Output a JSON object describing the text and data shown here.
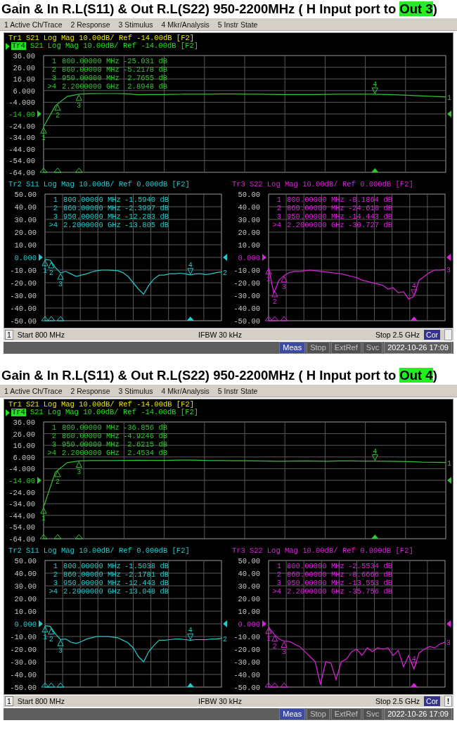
{
  "panels": [
    {
      "title": {
        "before": "Gain & In R.L(S11) & Out R.L(S22) 950-2200MHz ( H Input port to ",
        "highlight": "Out 3",
        "after": ")"
      },
      "menu": [
        "1 Active Ch/Trace",
        "2 Response",
        "3 Stimulus",
        "4 Mkr/Analysis",
        "5 Instr State"
      ],
      "top": {
        "headers": [
          {
            "trace": "Tr1",
            "param": "S21",
            "text": "Log Mag 10.00dB/ Ref -14.00dB [F2]",
            "color": "#e6e600",
            "selected": false
          },
          {
            "trace": "Tr4",
            "text": "Log Mag 10.00dB/ Ref -14.00dB [F2]",
            "color": "#22e022",
            "selected": true
          }
        ],
        "readout": [
          {
            "num": "1",
            "freq": "800.00000 MHz",
            "value": "-25.031 dB",
            "selected": false,
            "level": 0
          },
          {
            "num": "2",
            "freq": "860.00000 MHz",
            "value": "-5.2178 dB",
            "selected": false,
            "level": 0.035
          },
          {
            "num": "3",
            "freq": "950.00000 MHz",
            "value": "2.7655 dB",
            "selected": false,
            "level": 0.088
          },
          {
            "num": ">4",
            "freq": "2.2000000 GHz",
            "value": "2.8948 dB",
            "selected": true,
            "level": 0.824
          }
        ],
        "end_label": "1",
        "chart_data": {
          "type": "line",
          "grid": true,
          "categories": [
            null,
            null,
            null,
            null,
            null,
            null,
            null,
            null,
            null,
            null,
            null,
            null,
            null,
            null,
            null,
            null,
            null,
            null,
            null,
            null,
            null,
            null,
            null,
            null,
            null,
            null,
            null,
            null,
            null,
            null,
            null,
            null,
            null,
            null,
            null
          ],
          "ylim": [
            -64,
            36
          ],
          "yticks": [
            {
              "value": 36,
              "label": "36.00"
            },
            {
              "value": 26,
              "label": "26.00"
            },
            {
              "value": 16,
              "label": "16.00"
            },
            {
              "value": 6,
              "label": "6.000"
            },
            {
              "value": -4,
              "label": "-4.000"
            },
            {
              "value": -14,
              "label": "-14.00"
            },
            {
              "value": -24,
              "label": "-24.00"
            },
            {
              "value": -34,
              "label": "-34.00"
            },
            {
              "value": -44,
              "label": "-44.00"
            },
            {
              "value": -54,
              "label": "-54.00"
            },
            {
              "value": -64,
              "label": "-64.00"
            }
          ],
          "series": [
            {
              "name": "S21",
              "color": "#33c433",
              "values": [
                -25,
                -7,
                1,
                3,
                3.4,
                3.5,
                3.5,
                3.3,
                2.5,
                2.6,
                2.7,
                2.8,
                2.9,
                3,
                3,
                3.1,
                3.1,
                3,
                3,
                2.8,
                2.6,
                2.6,
                2.6,
                2.7,
                2.8,
                2.9,
                2.9,
                2.9,
                2.9,
                2.6,
                2.3,
                1.9,
                1.5,
                1,
                0.5
              ]
            }
          ],
          "annotations": [
            "1",
            "2",
            "3",
            "4"
          ]
        },
        "ref_arrows": true
      },
      "bottom": [
        {
          "headers": [
            {
              "trace": "Tr2",
              "text": "Log Mag 10.00dB/ Ref 0.000dB [F2]",
              "color": "#22cccc",
              "selected": false
            }
          ],
          "readout": [
            {
              "num": "1",
              "freq": "800.00000 MHz",
              "value": "-1.5940 dB",
              "selected": false,
              "level": 0
            },
            {
              "num": "2",
              "freq": "860.00000 MHz",
              "value": "-2.3997 dB",
              "selected": false,
              "level": 0.035
            },
            {
              "num": "3",
              "freq": "950.00000 MHz",
              "value": "-12.283 dB",
              "selected": false,
              "level": 0.088
            },
            {
              "num": ">4",
              "freq": "2.2000000 GHz",
              "value": "-13.805 dB",
              "selected": true,
              "level": 0.824
            }
          ],
          "end_label": "2",
          "chart_data": {
            "type": "line",
            "grid": true,
            "categories": [
              null,
              null,
              null,
              null,
              null,
              null,
              null,
              null,
              null,
              null,
              null,
              null,
              null,
              null,
              null,
              null,
              null,
              null,
              null,
              null,
              null,
              null,
              null,
              null,
              null,
              null,
              null,
              null,
              null,
              null,
              null,
              null,
              null,
              null,
              null
            ],
            "ylim": [
              -50,
              50
            ],
            "yticks": [
              {
                "value": 50,
                "label": "50.00"
              },
              {
                "value": 40,
                "label": "40.00"
              },
              {
                "value": 30,
                "label": "30.00"
              },
              {
                "value": 20,
                "label": "20.00"
              },
              {
                "value": 10,
                "label": "10.00"
              },
              {
                "value": 0,
                "label": "0.000"
              },
              {
                "value": -10,
                "label": "-10.00"
              },
              {
                "value": -20,
                "label": "-20.00"
              },
              {
                "value": -30,
                "label": "-30.00"
              },
              {
                "value": -40,
                "label": "-40.00"
              },
              {
                "value": -50,
                "label": "-50.00"
              }
            ],
            "series": [
              {
                "name": "S11",
                "color": "#22cccc",
                "values": [
                  -1.6,
                  -2.2,
                  -8,
                  -12.3,
                  -11,
                  -13,
                  -15,
                  -14,
                  -13,
                  -11.5,
                  -10.5,
                  -10,
                  -10,
                  -10.2,
                  -10.5,
                  -12,
                  -15,
                  -20,
                  -25,
                  -29,
                  -22,
                  -17,
                  -14,
                  -14,
                  -13,
                  -13,
                  -12.5,
                  -13,
                  -13.8,
                  -13,
                  -13,
                  -13.5,
                  -13,
                  -12,
                  -11.5
                ]
              }
            ],
            "annotations": [
              "1",
              "2",
              "3",
              "4"
            ]
          },
          "ref_arrows": true
        },
        {
          "headers": [
            {
              "trace": "Tr3",
              "text": "Log Mag 10.00dB/ Ref 0.000dB [F2]",
              "color": "#dd22dd",
              "selected": false
            }
          ],
          "readout": [
            {
              "num": "1",
              "freq": "800.00000 MHz",
              "value": "-8.1864 dB",
              "selected": false,
              "level": 0
            },
            {
              "num": "2",
              "freq": "860.00000 MHz",
              "value": "-24.610 dB",
              "selected": false,
              "level": 0.035
            },
            {
              "num": "3",
              "freq": "950.00000 MHz",
              "value": "-14.443 dB",
              "selected": false,
              "level": 0.088
            },
            {
              "num": ">4",
              "freq": "2.2000000 GHz",
              "value": "-30.727 dB",
              "selected": true,
              "level": 0.824
            }
          ],
          "end_label": "3",
          "chart_data": {
            "type": "line",
            "grid": true,
            "categories": [
              null,
              null,
              null,
              null,
              null,
              null,
              null,
              null,
              null,
              null,
              null,
              null,
              null,
              null,
              null,
              null,
              null,
              null,
              null,
              null,
              null,
              null,
              null,
              null,
              null,
              null,
              null,
              null,
              null,
              null,
              null,
              null,
              null,
              null,
              null
            ],
            "ylim": [
              -50,
              50
            ],
            "yticks": [
              {
                "value": 50,
                "label": "50.00"
              },
              {
                "value": 40,
                "label": "40.00"
              },
              {
                "value": 30,
                "label": "30.00"
              },
              {
                "value": 20,
                "label": "20.00"
              },
              {
                "value": 10,
                "label": "10.00"
              },
              {
                "value": 0,
                "label": "0.000"
              },
              {
                "value": -10,
                "label": "-10.00"
              },
              {
                "value": -20,
                "label": "-20.00"
              },
              {
                "value": -30,
                "label": "-30.00"
              },
              {
                "value": -40,
                "label": "-40.00"
              },
              {
                "value": -50,
                "label": "-50.00"
              }
            ],
            "series": [
              {
                "name": "S22",
                "color": "#dd22dd",
                "values": [
                  -8.2,
                  -28,
                  -18,
                  -14.4,
                  -12,
                  -11,
                  -11,
                  -10.5,
                  -10,
                  -10.5,
                  -11,
                  -11.5,
                  -12,
                  -12.5,
                  -13,
                  -14,
                  -15,
                  -16,
                  -18,
                  -19,
                  -20,
                  -21,
                  -22,
                  -25,
                  -24,
                  -28,
                  -27,
                  -33,
                  -30.7,
                  -18,
                  -15,
                  -12,
                  -10,
                  -10,
                  -9.5
                ]
              }
            ],
            "annotations": [
              "1",
              "2",
              "3",
              "4"
            ]
          },
          "ref_arrows": true
        }
      ],
      "status": {
        "channel": "1",
        "start": "Start 800 MHz",
        "ifbw": "IFBW 30 kHz",
        "stop": "Stop 2.5 GHz",
        "correction": {
          "label": "Cor",
          "on": true
        }
      },
      "bar": {
        "buttons": [
          {
            "label": "Meas",
            "active": true
          },
          {
            "label": "Stop",
            "active": false
          },
          {
            "label": "ExtRef",
            "active": false
          },
          {
            "label": "Svc",
            "active": false
          }
        ],
        "datetime": "2022-10-26 17:09"
      }
    },
    {
      "title": {
        "before": "Gain & In R.L(S11) & Out R.L(S22) 950-2200MHz ( H Input port to ",
        "highlight": "Out 4",
        "after": ")"
      },
      "menu": [
        "1 Active Ch/Trace",
        "2 Response",
        "3 Stimulus",
        "4 Mkr/Analysis",
        "5 Instr State"
      ],
      "top": {
        "headers": [
          {
            "trace": "Tr1",
            "param": "S21",
            "text": "Log Mag 10.00dB/ Ref -14.00dB [F2]",
            "color": "#e6e600",
            "selected": false
          },
          {
            "trace": "Tr4",
            "text": "Log Mag 10.00dB/ Ref -14.00dB [F2]",
            "color": "#22e022",
            "selected": true
          }
        ],
        "readout": [
          {
            "num": "1",
            "freq": "800.00000 MHz",
            "value": "-36.856 dB",
            "selected": false,
            "level": 0
          },
          {
            "num": "2",
            "freq": "860.00000 MHz",
            "value": "-4.9246 dB",
            "selected": false,
            "level": 0.035
          },
          {
            "num": "3",
            "freq": "950.00000 MHz",
            "value": "2.6215 dB",
            "selected": false,
            "level": 0.088
          },
          {
            "num": ">4",
            "freq": "2.2000000 GHz",
            "value": "2.4534 dB",
            "selected": true,
            "level": 0.824
          }
        ],
        "end_label": "1",
        "chart_data": {
          "type": "line",
          "grid": true,
          "categories": [
            null,
            null,
            null,
            null,
            null,
            null,
            null,
            null,
            null,
            null,
            null,
            null,
            null,
            null,
            null,
            null,
            null,
            null,
            null,
            null,
            null,
            null,
            null,
            null,
            null,
            null,
            null,
            null,
            null,
            null,
            null,
            null,
            null,
            null,
            null
          ],
          "ylim": [
            -64,
            36
          ],
          "yticks": [
            {
              "value": 36,
              "label": "36.00"
            },
            {
              "value": 26,
              "label": "26.00"
            },
            {
              "value": 16,
              "label": "16.00"
            },
            {
              "value": 6,
              "label": "6.000"
            },
            {
              "value": -4,
              "label": "-4.000"
            },
            {
              "value": -14,
              "label": "-14.00"
            },
            {
              "value": -24,
              "label": "-24.00"
            },
            {
              "value": -34,
              "label": "-34.00"
            },
            {
              "value": -44,
              "label": "-44.00"
            },
            {
              "value": -54,
              "label": "-54.00"
            },
            {
              "value": -64,
              "label": "-64.00"
            }
          ],
          "series": [
            {
              "name": "S21",
              "color": "#33c433",
              "values": [
                -36.9,
                -7,
                1.2,
                2.6,
                3,
                3,
                3,
                3.1,
                3.2,
                3.1,
                3.1,
                3.3,
                3.4,
                3.2,
                3,
                2.9,
                2.8,
                2.8,
                2.7,
                2.5,
                2.3,
                2.5,
                2.6,
                2.5,
                2.4,
                2.6,
                2.6,
                2.5,
                2.5,
                2.3,
                2.2,
                2,
                1.6,
                1.4,
                1.3
              ]
            }
          ],
          "annotations": [
            "1",
            "2",
            "3",
            "4"
          ]
        },
        "ref_arrows": true
      },
      "bottom": [
        {
          "headers": [
            {
              "trace": "Tr2",
              "text": "Log Mag 10.00dB/ Ref 0.000dB [F2]",
              "color": "#22cccc",
              "selected": false
            }
          ],
          "readout": [
            {
              "num": "1",
              "freq": "800.00000 MHz",
              "value": "-1.5038 dB",
              "selected": false,
              "level": 0
            },
            {
              "num": "2",
              "freq": "860.00000 MHz",
              "value": "-2.1781 dB",
              "selected": false,
              "level": 0.035
            },
            {
              "num": "3",
              "freq": "950.00000 MHz",
              "value": "-12.443 dB",
              "selected": false,
              "level": 0.088
            },
            {
              "num": ">4",
              "freq": "2.2000000 GHz",
              "value": "-13.048 dB",
              "selected": true,
              "level": 0.824
            }
          ],
          "end_label": "2",
          "chart_data": {
            "type": "line",
            "grid": true,
            "categories": [
              null,
              null,
              null,
              null,
              null,
              null,
              null,
              null,
              null,
              null,
              null,
              null,
              null,
              null,
              null,
              null,
              null,
              null,
              null,
              null,
              null,
              null,
              null,
              null,
              null,
              null,
              null,
              null,
              null,
              null,
              null,
              null,
              null,
              null,
              null
            ],
            "ylim": [
              -50,
              50
            ],
            "yticks": [
              {
                "value": 50,
                "label": "50.00"
              },
              {
                "value": 40,
                "label": "40.00"
              },
              {
                "value": 30,
                "label": "30.00"
              },
              {
                "value": 20,
                "label": "20.00"
              },
              {
                "value": 10,
                "label": "10.00"
              },
              {
                "value": 0,
                "label": "0.000"
              },
              {
                "value": -10,
                "label": "-10.00"
              },
              {
                "value": -20,
                "label": "-20.00"
              },
              {
                "value": -30,
                "label": "-30.00"
              },
              {
                "value": -40,
                "label": "-40.00"
              },
              {
                "value": -50,
                "label": "-50.00"
              }
            ],
            "series": [
              {
                "name": "S11",
                "color": "#22cccc",
                "values": [
                  -1.5,
                  -2,
                  -8,
                  -12.4,
                  -12,
                  -14.5,
                  -15.5,
                  -14,
                  -12,
                  -11,
                  -10,
                  -10,
                  -10,
                  -10.5,
                  -11,
                  -13,
                  -15,
                  -19,
                  -26,
                  -30,
                  -22,
                  -17,
                  -13,
                  -13,
                  -12.5,
                  -12,
                  -12,
                  -12.5,
                  -13,
                  -12.5,
                  -12.5,
                  -12.5,
                  -12,
                  -12,
                  -11.5
                ]
              }
            ],
            "annotations": [
              "1",
              "2",
              "3",
              "4"
            ]
          },
          "ref_arrows": true
        },
        {
          "headers": [
            {
              "trace": "Tr3",
              "text": "Log Mag 10.00dB/ Ref 0.000dB [F2]",
              "color": "#dd22dd",
              "selected": false
            }
          ],
          "readout": [
            {
              "num": "1",
              "freq": "800.00000 MHz",
              "value": "-2.5534 dB",
              "selected": false,
              "level": 0
            },
            {
              "num": "2",
              "freq": "860.00000 MHz",
              "value": "-8.6666 dB",
              "selected": false,
              "level": 0.035
            },
            {
              "num": "3",
              "freq": "950.00000 MHz",
              "value": "-13.553 dB",
              "selected": false,
              "level": 0.088
            },
            {
              "num": ">4",
              "freq": "2.2000000 GHz",
              "value": "-35.756 dB",
              "selected": true,
              "level": 0.824
            }
          ],
          "end_label": "3",
          "chart_data": {
            "type": "line",
            "grid": true,
            "categories": [
              null,
              null,
              null,
              null,
              null,
              null,
              null,
              null,
              null,
              null,
              null,
              null,
              null,
              null,
              null,
              null,
              null,
              null,
              null,
              null,
              null,
              null,
              null,
              null,
              null,
              null,
              null,
              null,
              null,
              null,
              null,
              null,
              null,
              null,
              null
            ],
            "ylim": [
              -50,
              50
            ],
            "yticks": [
              {
                "value": 50,
                "label": "50.00"
              },
              {
                "value": 40,
                "label": "40.00"
              },
              {
                "value": 30,
                "label": "30.00"
              },
              {
                "value": 20,
                "label": "20.00"
              },
              {
                "value": 10,
                "label": "10.00"
              },
              {
                "value": 0,
                "label": "0.000"
              },
              {
                "value": -10,
                "label": "-10.00"
              },
              {
                "value": -20,
                "label": "-20.00"
              },
              {
                "value": -30,
                "label": "-30.00"
              },
              {
                "value": -40,
                "label": "-40.00"
              },
              {
                "value": -50,
                "label": "-50.00"
              }
            ],
            "series": [
              {
                "name": "S22",
                "color": "#dd22dd",
                "values": [
                  -2.6,
                  -8,
                  -12,
                  -13.6,
                  -14,
                  -16,
                  -18,
                  -22,
                  -26,
                  -30,
                  -48,
                  -30,
                  -31,
                  -44,
                  -30,
                  -28,
                  -22,
                  -20,
                  -25,
                  -19,
                  -22,
                  -19,
                  -20,
                  -19,
                  -25,
                  -21,
                  -34,
                  -25,
                  -35.8,
                  -23,
                  -20,
                  -18,
                  -19,
                  -16,
                  -14.5
                ]
              }
            ],
            "annotations": [
              "1",
              "2",
              "3",
              "4"
            ]
          },
          "ref_arrows": true
        }
      ],
      "status": {
        "channel": "1",
        "start": "Start 800 MHz",
        "ifbw": "IFBW 30 kHz",
        "stop": "Stop 2.5 GHz",
        "correction": {
          "label": "Cor",
          "on": true
        },
        "alert": "!"
      },
      "bar": {
        "buttons": [
          {
            "label": "Meas",
            "active": true
          },
          {
            "label": "Stop",
            "active": false
          },
          {
            "label": "ExtRef",
            "active": false
          },
          {
            "label": "Svc",
            "active": false
          }
        ],
        "datetime": "2022-10-26 17:09"
      }
    }
  ]
}
